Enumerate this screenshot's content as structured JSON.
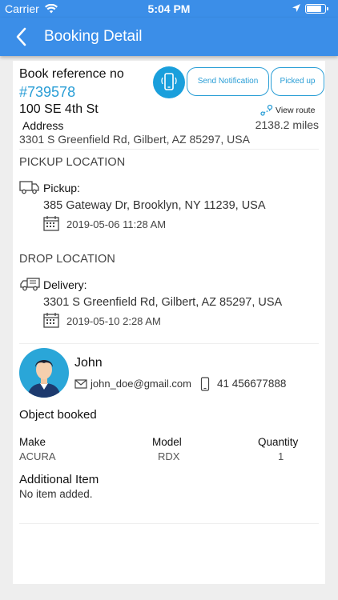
{
  "status_bar": {
    "carrier": "Carrier",
    "time": "5:04 PM",
    "battery_level": 0.8
  },
  "nav": {
    "title": "Booking Detail"
  },
  "booking": {
    "ref_label": "Book reference no",
    "ref_number": "#739578",
    "actions": {
      "notify_label": "Send Notification",
      "picked_label": "Picked up"
    },
    "address_title": "100 SE 4th St",
    "address_label": "Address",
    "address_full": "3301 S Greenfield Rd, Gilbert, AZ 85297, USA",
    "route_label": "View route",
    "distance": "2138.2 miles"
  },
  "pickup": {
    "heading": "PICKUP LOCATION",
    "type_label": "Pickup:",
    "address": "385 Gateway Dr, Brooklyn, NY 11239, USA",
    "datetime": "2019-05-06 11:28 AM"
  },
  "drop": {
    "heading": "DROP LOCATION",
    "type_label": "Delivery:",
    "address": "3301 S Greenfield Rd, Gilbert, AZ 85297, USA",
    "datetime": "2019-05-10 2:28 AM"
  },
  "customer": {
    "name": "John",
    "email": "john_doe@gmail.com",
    "phone": "41 456677888"
  },
  "object": {
    "title": "Object booked",
    "headers": {
      "make": "Make",
      "model": "Model",
      "quantity": "Quantity"
    },
    "row": {
      "make": "ACURA",
      "model": "RDX",
      "quantity": "1"
    }
  },
  "additional": {
    "title": "Additional Item",
    "value": "No item added."
  },
  "colors": {
    "primary": "#3b8ee8",
    "accent": "#2a9ed6",
    "phone_button": "#1a9fdc"
  }
}
